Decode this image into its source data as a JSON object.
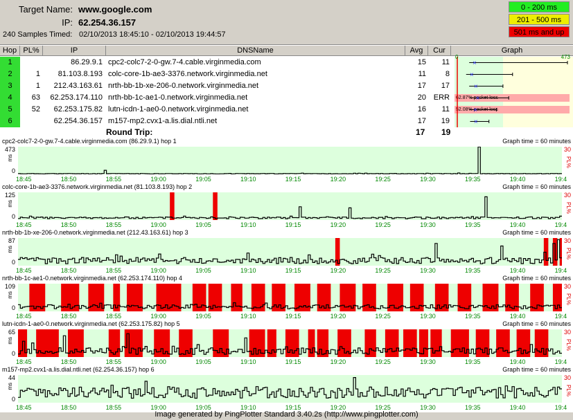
{
  "header": {
    "target_label": "Target Name:",
    "target_value": "www.google.com",
    "ip_label": "IP:",
    "ip_value": "62.254.36.157",
    "samples_label": "240 Samples Timed:",
    "samples_value": "02/10/2013 18:45:10 - 02/10/2013 19:44:57"
  },
  "legend": {
    "green": "0 - 200 ms",
    "yellow": "201 - 500 ms",
    "red": "501 ms and up",
    "colors": {
      "green": "#22ee22",
      "yellow": "#eeee00",
      "red": "#ee0000"
    }
  },
  "table": {
    "columns": [
      "Hop",
      "PL%",
      "IP",
      "DNSName",
      "Avg",
      "Cur",
      "Graph"
    ],
    "graph_scale_min": "0",
    "graph_scale_max": "473",
    "rows": [
      {
        "hop": "1",
        "pl": "",
        "ip": "86.29.9.1",
        "dns": "cpc2-colc7-2-0-gw.7-4.cable.virginmedia.com",
        "avg": "15",
        "cur": "11",
        "loss": "",
        "avg_ms": 15,
        "min_ms": 8,
        "max_ms": 473
      },
      {
        "hop": "2",
        "pl": "1",
        "ip": "81.103.8.193",
        "dns": "colc-core-1b-ae3-3376.network.virginmedia.net",
        "avg": "11",
        "cur": "8",
        "loss": "",
        "avg_ms": 11,
        "min_ms": 5,
        "max_ms": 125
      },
      {
        "hop": "3",
        "pl": "1",
        "ip": "212.43.163.61",
        "dns": "nrth-bb-1b-xe-206-0.network.virginmedia.net",
        "avg": "17",
        "cur": "17",
        "loss": "",
        "avg_ms": 17,
        "min_ms": 8,
        "max_ms": 87
      },
      {
        "hop": "4",
        "pl": "63",
        "ip": "62.253.174.110",
        "dns": "nrth-bb-1c-ae1-0.network.virginmedia.net",
        "avg": "20",
        "cur": "ERR",
        "loss": "62.87% packet loss",
        "avg_ms": 20,
        "min_ms": 9,
        "max_ms": 109
      },
      {
        "hop": "5",
        "pl": "52",
        "ip": "62.253.175.82",
        "dns": "lutn-icdn-1-ae0-0.network.virginmedia.net",
        "avg": "16",
        "cur": "11",
        "loss": "52.08% packet loss",
        "avg_ms": 16,
        "min_ms": 8,
        "max_ms": 65
      },
      {
        "hop": "6",
        "pl": "",
        "ip": "62.254.36.157",
        "dns": "m157-mp2.cvx1-a.lis.dial.ntli.net",
        "avg": "17",
        "cur": "19",
        "loss": "",
        "avg_ms": 17,
        "min_ms": 9,
        "max_ms": 44
      }
    ],
    "round_trip_label": "Round Trip:",
    "round_trip_avg": "17",
    "round_trip_cur": "19"
  },
  "panels": [
    {
      "title": "cpc2-colc7-2-0-gw.7-4.cable.virginmedia.com (86.29.9.1) hop 1",
      "graph_time": "Graph time = 60 minutes",
      "ymax": "473",
      "ymax_num": 473,
      "ymin": "0",
      "pl_max": "30",
      "pl_label": "PL%",
      "ms_label": "ms",
      "base": 12,
      "noise": 4,
      "seed": 11,
      "spikes": [
        [
          38,
          70
        ],
        [
          203,
          470
        ]
      ],
      "losses": []
    },
    {
      "title": "colc-core-1b-ae3-3376.network.virginmedia.net (81.103.8.193) hop 2",
      "graph_time": "Graph time = 60 minutes",
      "ymax": "125",
      "ymax_num": 125,
      "ymin": "0",
      "pl_max": "30",
      "pl_label": "PL%",
      "ms_label": "ms",
      "base": 10,
      "noise": 4,
      "seed": 23,
      "spikes": [
        [
          206,
          105
        ],
        [
          124,
          60
        ],
        [
          146,
          55
        ]
      ],
      "losses": [
        [
          67,
          68
        ],
        [
          86,
          87
        ]
      ]
    },
    {
      "title": "nrth-bb-1b-xe-206-0.network.virginmedia.net (212.43.163.61) hop 3",
      "graph_time": "Graph time = 60 minutes",
      "ymax": "87",
      "ymax_num": 87,
      "ymin": "0",
      "pl_max": "30",
      "pl_label": "PL%",
      "ms_label": "ms",
      "base": 16,
      "noise": 10,
      "seed": 37,
      "spikes": [
        [
          184,
          70
        ],
        [
          213,
          62
        ],
        [
          238,
          82
        ],
        [
          236,
          70
        ]
      ],
      "losses": [
        [
          140,
          141
        ],
        [
          232,
          233
        ],
        [
          236,
          237
        ],
        [
          239,
          240
        ]
      ]
    },
    {
      "title": "nrth-bb-1c-ae1-0.network.virginmedia.net (62.253.174.110) hop 4",
      "graph_time": "Graph time = 60 minutes",
      "ymax": "109",
      "ymax_num": 109,
      "ymin": "0",
      "pl_max": "30",
      "pl_label": "PL%",
      "ms_label": "ms",
      "base": 18,
      "noise": 8,
      "seed": 53,
      "spikes": [],
      "losses": [
        [
          5,
          11
        ],
        [
          19,
          26
        ],
        [
          31,
          37
        ],
        [
          42,
          44
        ],
        [
          48,
          54
        ],
        [
          61,
          71
        ],
        [
          77,
          82
        ],
        [
          84,
          89
        ],
        [
          94,
          98
        ],
        [
          103,
          108
        ],
        [
          112,
          117
        ],
        [
          122,
          128
        ],
        [
          132,
          137
        ],
        [
          142,
          148
        ],
        [
          152,
          157
        ],
        [
          163,
          169
        ],
        [
          173,
          178
        ],
        [
          184,
          189
        ],
        [
          194,
          199
        ],
        [
          205,
          211
        ],
        [
          215,
          220
        ],
        [
          226,
          231
        ],
        [
          236,
          241
        ]
      ]
    },
    {
      "title": "lutn-icdn-1-ae0-0.network.virginmedia.net (62.253.175.82) hop 5",
      "graph_time": "Graph time = 60 minutes",
      "ymax": "65",
      "ymax_num": 65,
      "ymin": "0",
      "pl_max": "30",
      "pl_label": "PL%",
      "ms_label": "ms",
      "base": 14,
      "noise": 8,
      "seed": 71,
      "spikes": [
        [
          20,
          50
        ],
        [
          48,
          55
        ],
        [
          100,
          45
        ]
      ],
      "losses": [
        [
          0,
          3
        ],
        [
          8,
          17
        ],
        [
          22,
          28
        ],
        [
          40,
          44
        ],
        [
          47,
          54
        ],
        [
          60,
          66
        ],
        [
          71,
          76
        ],
        [
          86,
          92
        ],
        [
          102,
          108
        ],
        [
          110,
          113
        ],
        [
          118,
          123
        ],
        [
          128,
          130
        ],
        [
          132,
          136
        ],
        [
          141,
          146
        ],
        [
          153,
          157
        ],
        [
          162,
          167
        ],
        [
          170,
          175
        ],
        [
          177,
          180
        ],
        [
          182,
          186
        ],
        [
          191,
          198
        ],
        [
          202,
          207
        ],
        [
          211,
          216
        ],
        [
          220,
          225
        ],
        [
          228,
          233
        ]
      ]
    },
    {
      "title": "m157-mp2.cvx1-a.lis.dial.ntli.net (62.254.36.157) hop 6",
      "graph_time": "Graph time = 60 minutes",
      "ymax": "44",
      "ymax_num": 44,
      "ymin": "0",
      "pl_max": "30",
      "pl_label": "PL%",
      "ms_label": "ms",
      "base": 16,
      "noise": 9,
      "seed": 97,
      "spikes": [
        [
          148,
          40
        ]
      ],
      "losses": []
    }
  ],
  "x_ticks": [
    "18:45",
    "18:50",
    "18:55",
    "19:00",
    "19:05",
    "19:10",
    "19:15",
    "19:20",
    "19:25",
    "19:30",
    "19:35",
    "19:40",
    "19:4"
  ],
  "footer": "Image generated by PingPlotter Standard 3.40.2s (http://www.pingplotter.com)"
}
